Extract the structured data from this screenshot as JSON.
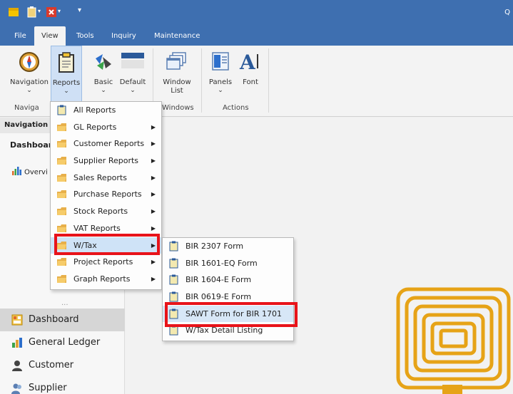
{
  "titlebar": {
    "right_text": "Q"
  },
  "ribbon_tabs": [
    "File",
    "View",
    "Tools",
    "Inquiry",
    "Maintenance"
  ],
  "ribbon": {
    "navigation": "Navigation",
    "reports": "Reports",
    "basic": "Basic",
    "default": "Default",
    "window_list": "Window List",
    "panels": "Panels",
    "font": "Font",
    "group_navigation": "Naviga",
    "group_windows": "Windows",
    "group_actions": "Actions"
  },
  "nav": {
    "header": "Navigation",
    "dashboard_sub": "Dashboar",
    "overview": "Overvi",
    "dots": "...",
    "items": [
      "Dashboard",
      "General Ledger",
      "Customer",
      "Supplier"
    ]
  },
  "reports_menu": [
    {
      "label": "All Reports",
      "submenu": false
    },
    {
      "label": "GL Reports",
      "submenu": true
    },
    {
      "label": "Customer Reports",
      "submenu": true
    },
    {
      "label": "Supplier Reports",
      "submenu": true
    },
    {
      "label": "Sales Reports",
      "submenu": true
    },
    {
      "label": "Purchase Reports",
      "submenu": true
    },
    {
      "label": "Stock Reports",
      "submenu": true
    },
    {
      "label": "VAT Reports",
      "submenu": true
    },
    {
      "label": "W/Tax",
      "submenu": true
    },
    {
      "label": "Project Reports",
      "submenu": true
    },
    {
      "label": "Graph Reports",
      "submenu": true
    }
  ],
  "wtax_menu": [
    "BIR 2307 Form",
    "BIR 1601-EQ Form",
    "BIR 1604-E Form",
    "BIR 0619-E Form",
    "SAWT Form for BIR 1701",
    "W/Tax Detail Listing"
  ],
  "colors": {
    "titlebar": "#3e6fb0",
    "highlight": "#e8131a",
    "menu_hover": "#cfe3f7",
    "logo": "#e6a317"
  }
}
